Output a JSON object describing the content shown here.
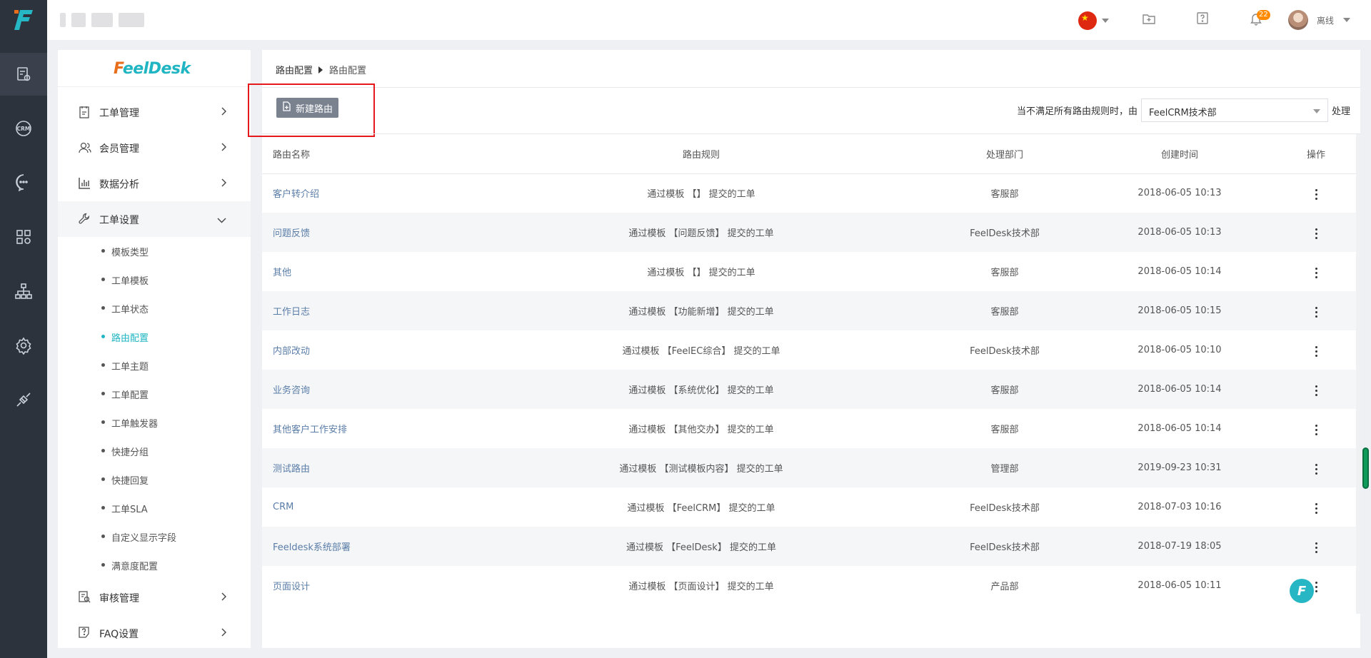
{
  "rail": {
    "logo_letter": "F",
    "items": [
      {
        "icon": "ticket-settings-icon"
      },
      {
        "icon": "crm-icon",
        "label": "CRM"
      },
      {
        "icon": "chat-icon"
      },
      {
        "icon": "apps-icon"
      },
      {
        "icon": "org-tree-icon"
      },
      {
        "icon": "settings-icon"
      },
      {
        "icon": "plug-icon"
      }
    ]
  },
  "header": {
    "language_flag": "china-flag-icon",
    "notification_count": "22",
    "username": "离线"
  },
  "sidebar": {
    "brand": {
      "lead": "F",
      "rest": "eelDesk"
    },
    "menu": [
      {
        "label": "工单管理",
        "icon": "ticket-icon"
      },
      {
        "label": "会员管理",
        "icon": "members-icon"
      },
      {
        "label": "数据分析",
        "icon": "bar-chart-icon"
      },
      {
        "label": "工单设置",
        "icon": "wrench-icon"
      }
    ],
    "sub_items": [
      {
        "label": "模板类型"
      },
      {
        "label": "工单模板"
      },
      {
        "label": "工单状态"
      },
      {
        "label": "路由配置"
      },
      {
        "label": "工单主题"
      },
      {
        "label": "工单配置"
      },
      {
        "label": "工单触发器"
      },
      {
        "label": "快捷分组"
      },
      {
        "label": "快捷回复"
      },
      {
        "label": "工单SLA"
      },
      {
        "label": "自定义显示字段"
      },
      {
        "label": "满意度配置"
      }
    ],
    "bottom_menu": [
      {
        "label": "审核管理",
        "icon": "audit-icon"
      },
      {
        "label": "FAQ设置",
        "icon": "faq-icon"
      }
    ]
  },
  "main": {
    "breadcrumb": {
      "parent": "路由配置",
      "current": "路由配置"
    },
    "new_button_label": "新建路由",
    "fallback": {
      "prefix": "当不满足所有路由规则时，由",
      "department": "FeelCRM技术部",
      "suffix": "处理"
    },
    "table": {
      "columns": {
        "name": "路由名称",
        "rule": "路由规则",
        "dept": "处理部门",
        "created": "创建时间",
        "ops": "操作"
      },
      "rows": [
        {
          "name": "客户转介绍",
          "rule": "通过模板 【】 提交的工单",
          "dept": "客服部",
          "created": "2018-06-05 10:13"
        },
        {
          "name": "问题反馈",
          "rule": "通过模板 【问题反馈】 提交的工单",
          "dept": "FeelDesk技术部",
          "created": "2018-06-05 10:13"
        },
        {
          "name": "其他",
          "rule": "通过模板 【】 提交的工单",
          "dept": "客服部",
          "created": "2018-06-05 10:14"
        },
        {
          "name": "工作日志",
          "rule": "通过模板 【功能新增】 提交的工单",
          "dept": "客服部",
          "created": "2018-06-05 10:15"
        },
        {
          "name": "内部改动",
          "rule": "通过模板 【FeelEC综合】 提交的工单",
          "dept": "FeelDesk技术部",
          "created": "2018-06-05 10:10"
        },
        {
          "name": "业务咨询",
          "rule": "通过模板 【系统优化】 提交的工单",
          "dept": "客服部",
          "created": "2018-06-05 10:14"
        },
        {
          "name": "其他客户工作安排",
          "rule": "通过模板 【其他交办】 提交的工单",
          "dept": "客服部",
          "created": "2018-06-05 10:14"
        },
        {
          "name": "测试路由",
          "rule": "通过模板 【测试模板内容】 提交的工单",
          "dept": "管理部",
          "created": "2019-09-23 10:31"
        },
        {
          "name": "CRM",
          "rule": "通过模板 【FeelCRM】 提交的工单",
          "dept": "FeelDesk技术部",
          "created": "2018-07-03 10:16"
        },
        {
          "name": "Feeldesk系统部署",
          "rule": "通过模板 【FeelDesk】 提交的工单",
          "dept": "FeelDesk技术部",
          "created": "2018-07-19 18:05"
        },
        {
          "name": "页面设计",
          "rule": "通过模板 【页面设计】 提交的工单",
          "dept": "产品部",
          "created": "2018-06-05 10:11"
        }
      ]
    }
  },
  "floating_button_letter": "F",
  "colors": {
    "rail": "#2d333d",
    "accent": "#1fb5c2",
    "highlight": "#e5191c",
    "button": "#7a8290",
    "link": "#5a7da8"
  }
}
